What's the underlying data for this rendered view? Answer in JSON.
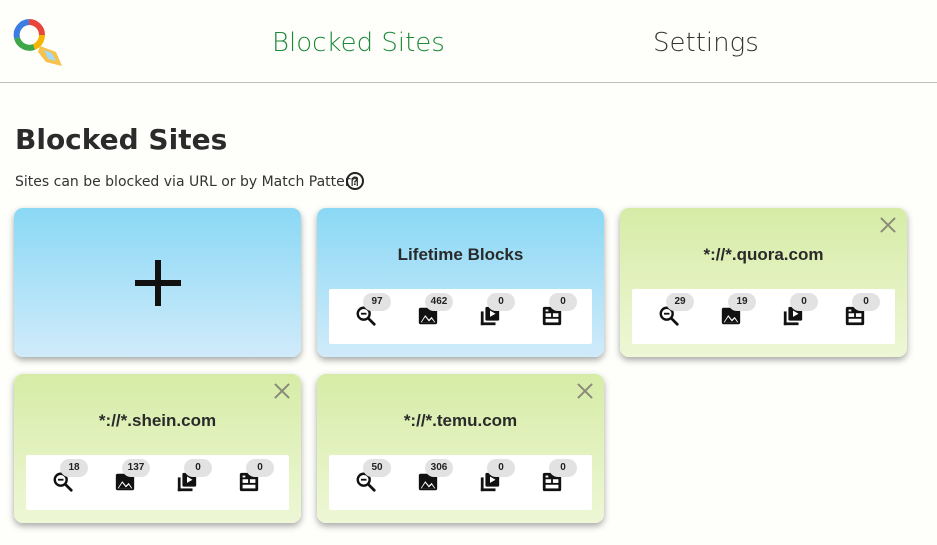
{
  "nav": {
    "blocked_sites": "Blocked Sites",
    "settings": "Settings"
  },
  "page": {
    "title": "Blocked Sites",
    "subtitle": "Sites can be blocked via URL or by Match Pattern",
    "help_glyph": "?"
  },
  "colors": {
    "accent_green": "#1e8a3a",
    "blue_card": "#8ad8f5",
    "green_card": "#d6eca6"
  },
  "stat_icons": [
    "search-blocks-icon",
    "image-blocks-icon",
    "video-blocks-icon",
    "frame-blocks-icon"
  ],
  "cards": [
    {
      "title": "Lifetime Blocks",
      "stats": [
        "97",
        "462",
        "0",
        "0"
      ]
    },
    {
      "title": "*://*.quora.com",
      "stats": [
        "29",
        "19",
        "0",
        "0"
      ]
    },
    {
      "title": "*://*.shein.com",
      "stats": [
        "18",
        "137",
        "0",
        "0"
      ]
    },
    {
      "title": "*://*.temu.com",
      "stats": [
        "50",
        "306",
        "0",
        "0"
      ]
    }
  ]
}
